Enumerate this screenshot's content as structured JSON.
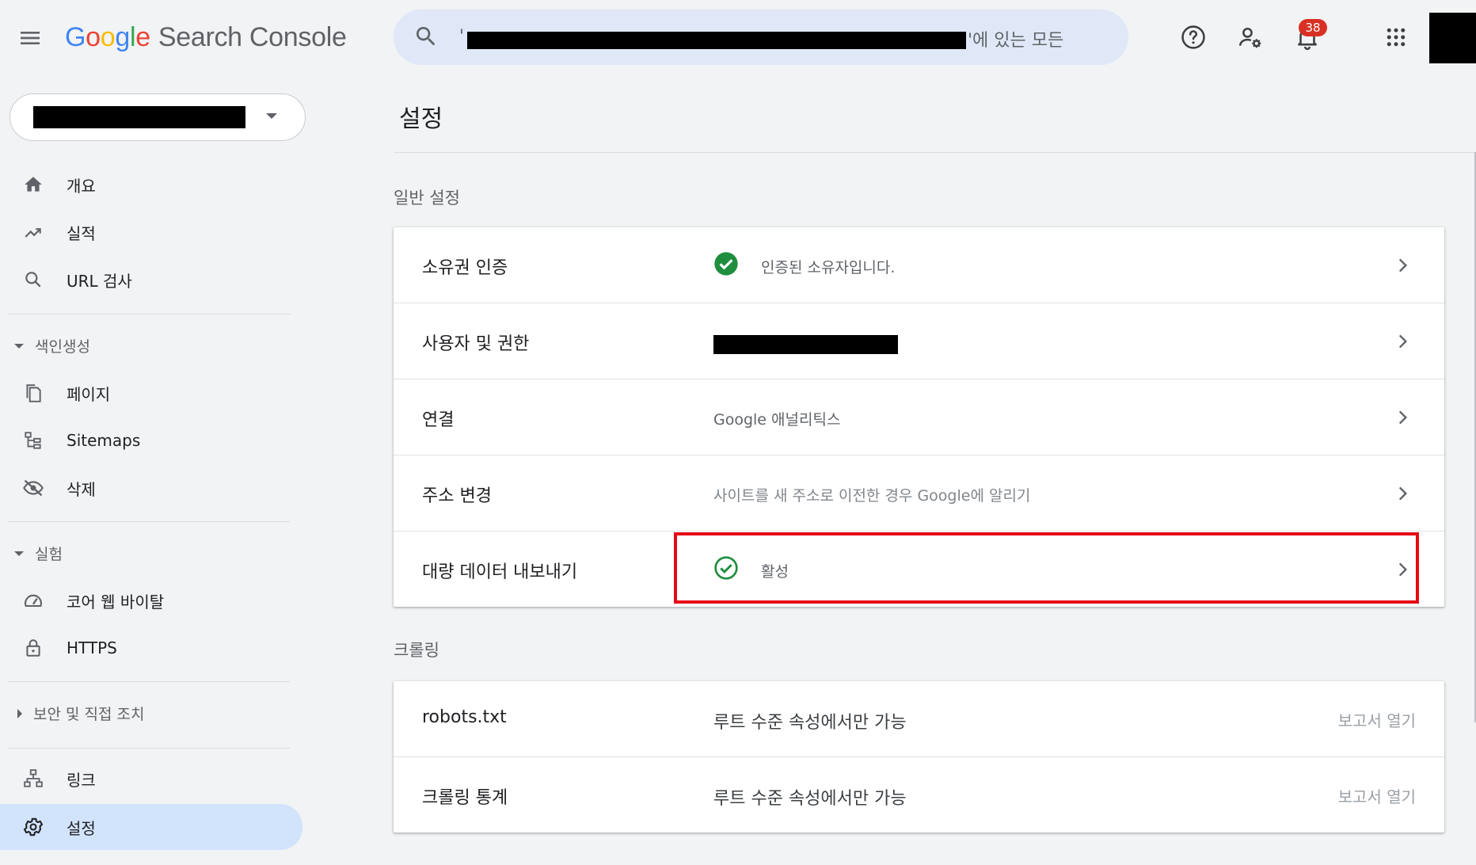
{
  "app": {
    "logo_letters": [
      "G",
      "o",
      "o",
      "g",
      "l",
      "e"
    ],
    "product": "Search Console"
  },
  "search": {
    "quote": "'",
    "suffix_text": "'에 있는 모든"
  },
  "notifications": {
    "count": "38"
  },
  "sidebar": {
    "items_top": [
      {
        "label": "개요",
        "icon": "home-icon"
      },
      {
        "label": "실적",
        "icon": "trending-up-icon"
      },
      {
        "label": "URL 검사",
        "icon": "search-icon"
      }
    ],
    "section_indexing": {
      "label": "색인생성",
      "items": [
        {
          "label": "페이지",
          "icon": "pages-icon"
        },
        {
          "label": "Sitemaps",
          "icon": "sitemap-icon"
        },
        {
          "label": "삭제",
          "icon": "eye-off-icon"
        }
      ]
    },
    "section_experience": {
      "label": "실험",
      "items": [
        {
          "label": "코어 웹 바이탈",
          "icon": "gauge-icon"
        },
        {
          "label": "HTTPS",
          "icon": "lock-icon"
        }
      ]
    },
    "section_security": {
      "label": "보안 및 직접 조치"
    },
    "items_bottom": [
      {
        "label": "링크",
        "icon": "links-icon"
      },
      {
        "label": "설정",
        "icon": "gear-icon",
        "active": true
      }
    ]
  },
  "main": {
    "title": "설정",
    "general": {
      "heading": "일반 설정",
      "rows": [
        {
          "label": "소유권 인증",
          "value": "인증된 소유자입니다."
        },
        {
          "label": "사용자 및 권한",
          "value": ""
        },
        {
          "label": "연결",
          "value": "Google 애널리틱스"
        },
        {
          "label": "주소 변경",
          "value": "사이트를 새 주소로 이전한 경우 Google에 알리기"
        },
        {
          "label": "대량 데이터 내보내기",
          "value": "활성"
        }
      ]
    },
    "crawling": {
      "heading": "크롤링",
      "rows": [
        {
          "label": "robots.txt",
          "value": "루트 수준 속성에서만 가능",
          "action": "보고서 열기"
        },
        {
          "label": "크롤링 통계",
          "value": "루트 수준 속성에서만 가능",
          "action": "보고서 열기"
        }
      ]
    }
  },
  "colors": {
    "accent": "#1a73e8",
    "active_nav": "#d2e3fc",
    "success": "#1e8e3e",
    "highlight": "#e50914",
    "badge": "#d93025"
  }
}
